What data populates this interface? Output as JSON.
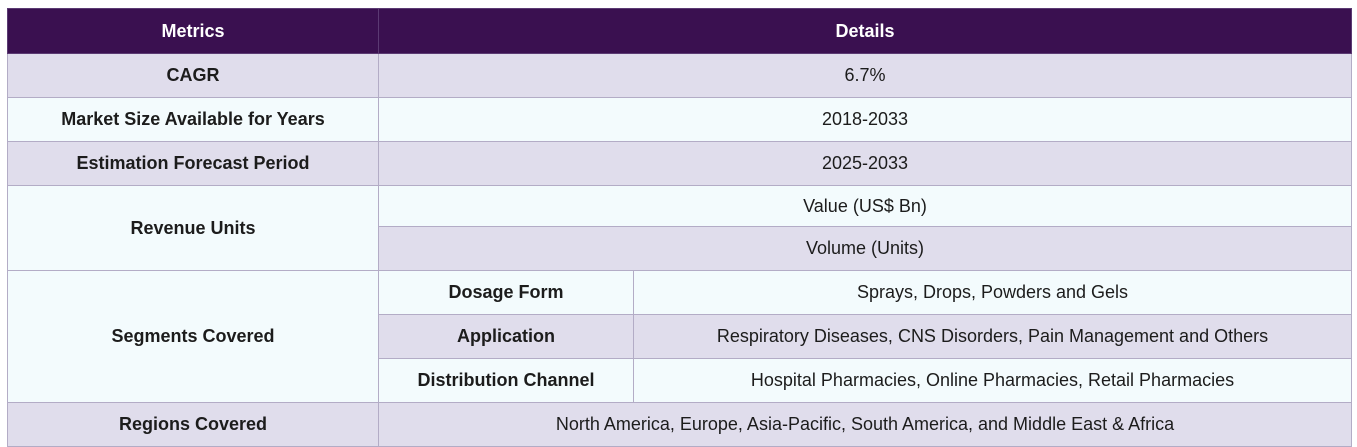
{
  "header": {
    "metrics": "Metrics",
    "details": "Details"
  },
  "rows": {
    "cagr": {
      "label": "CAGR",
      "value": "6.7%"
    },
    "market_size_years": {
      "label": "Market Size Available for Years",
      "value": "2018-2033"
    },
    "forecast_period": {
      "label": "Estimation Forecast Period",
      "value": "2025-2033"
    },
    "revenue_units": {
      "label": "Revenue Units",
      "values": [
        "Value (US$ Bn)",
        "Volume (Units)"
      ]
    },
    "segments": {
      "label": "Segments Covered",
      "items": [
        {
          "name": "Dosage Form",
          "value": "Sprays, Drops, Powders and Gels"
        },
        {
          "name": "Application",
          "value": "Respiratory Diseases, CNS Disorders, Pain Management and Others"
        },
        {
          "name": "Distribution Channel",
          "value": "Hospital Pharmacies, Online Pharmacies, Retail Pharmacies"
        }
      ]
    },
    "regions": {
      "label": "Regions Covered",
      "value": "North America, Europe, Asia-Pacific, South America, and Middle East & Africa"
    }
  },
  "colors": {
    "header_bg": "#3a1050",
    "row_lavender": "#e0ddec",
    "row_ice": "#f3fbfd",
    "border": "#b3acc6"
  }
}
